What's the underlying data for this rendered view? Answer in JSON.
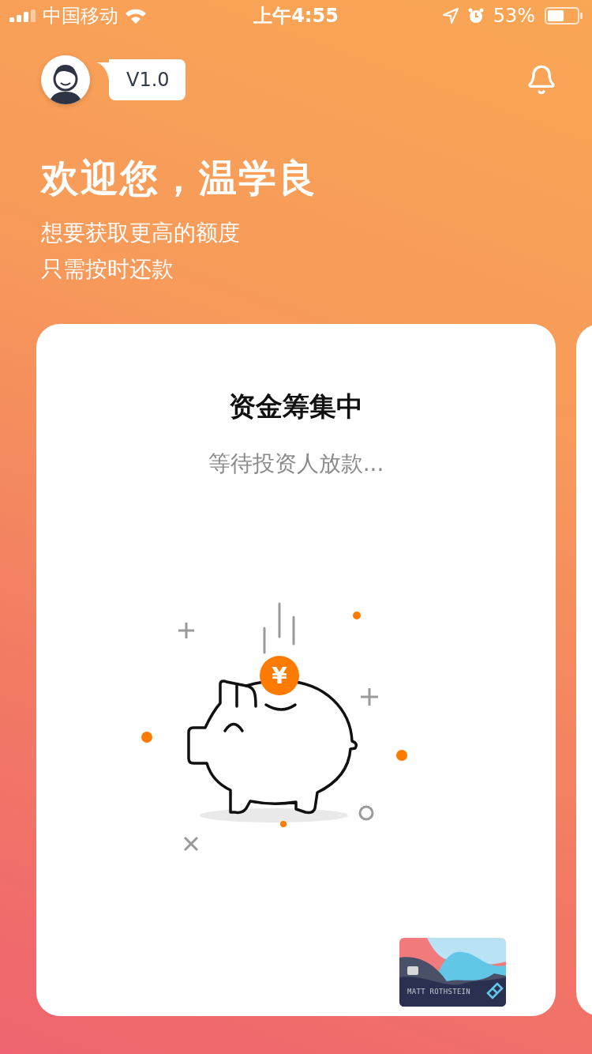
{
  "status_bar": {
    "carrier": "中国移动",
    "time": "上午4:55",
    "battery": "53%"
  },
  "header": {
    "version": "V1.0"
  },
  "greeting": {
    "title": "欢迎您，温学良",
    "lines": [
      "想要获取更高的额度",
      "只需按时还款"
    ]
  },
  "card": {
    "title": "资金筹集中",
    "subtitle": "等待投资人放款...",
    "coin_symbol": "¥",
    "bank_card": {
      "holder": "MATT ROTHSTEIN"
    }
  }
}
